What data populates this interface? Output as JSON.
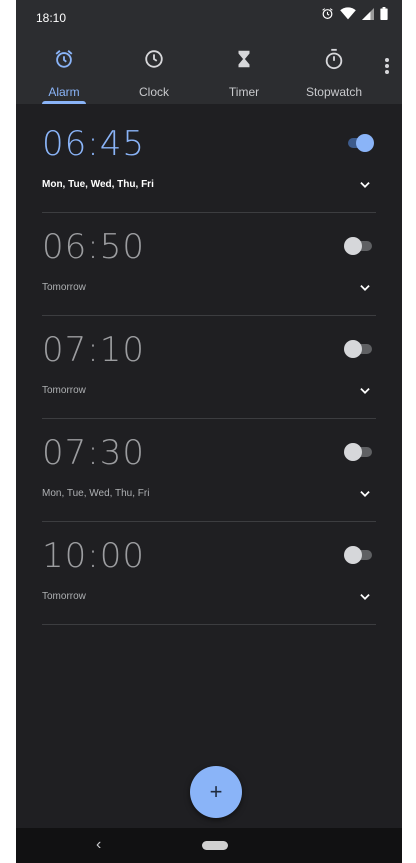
{
  "status_bar": {
    "time": "18:10",
    "icons": [
      "alarm-clock-icon",
      "wifi-icon",
      "signal-icon",
      "battery-icon"
    ]
  },
  "tabs": [
    {
      "label": "Alarm",
      "icon": "alarm-icon",
      "active": true
    },
    {
      "label": "Clock",
      "icon": "clock-icon",
      "active": false
    },
    {
      "label": "Timer",
      "icon": "hourglass-icon",
      "active": false
    },
    {
      "label": "Stopwatch",
      "icon": "stopwatch-icon",
      "active": false
    }
  ],
  "alarms": [
    {
      "time": "06:45",
      "repeat": "Mon, Tue, Wed, Thu, Fri",
      "enabled": true
    },
    {
      "time": "06:50",
      "repeat": "Tomorrow",
      "enabled": false
    },
    {
      "time": "07:10",
      "repeat": "Tomorrow",
      "enabled": false
    },
    {
      "time": "07:30",
      "repeat": "Mon, Tue, Wed, Thu, Fri",
      "enabled": false
    },
    {
      "time": "10:00",
      "repeat": "Tomorrow",
      "enabled": false
    }
  ],
  "fab": {
    "label": "+"
  },
  "nav": {
    "back": "‹"
  },
  "colors": {
    "accent": "#8ab4f8",
    "background": "#1f1f22",
    "bar": "#2c2d30"
  }
}
